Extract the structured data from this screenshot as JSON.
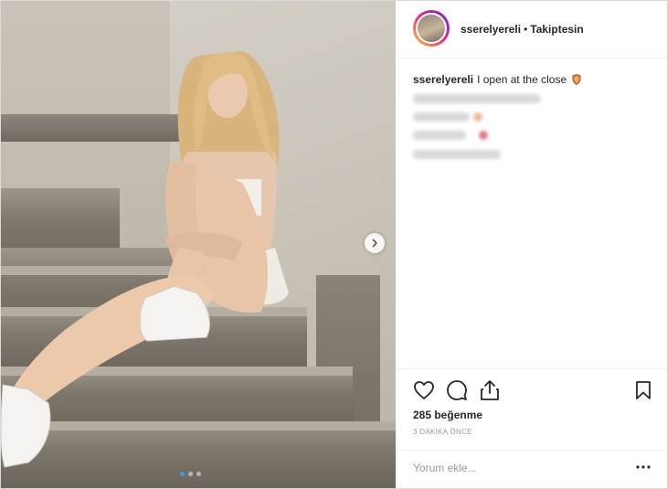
{
  "post": {
    "image_alt": "Young woman sitting on marble stairs",
    "carousel": {
      "count": 3,
      "active_index": 0
    }
  },
  "header": {
    "username": "sserelyereli",
    "separator": "•",
    "follow_label": "Takiptesin"
  },
  "caption": {
    "username": "sserelyereli",
    "text": "I open at the close",
    "emoji_icon": "shield-emoji-icon"
  },
  "actions": {
    "like_icon": "heart-icon",
    "comment_icon": "comment-icon",
    "share_icon": "share-icon",
    "save_icon": "bookmark-icon"
  },
  "likes_label": "285 beğenme",
  "timestamp": "3 DAKİKA ÖNCE",
  "comment_box": {
    "placeholder": "Yorum ekle...",
    "more_icon": "more-options-icon"
  },
  "colors": {
    "accent": "#3897f0",
    "text": "#262626",
    "muted": "#999999",
    "border": "#efefef"
  }
}
